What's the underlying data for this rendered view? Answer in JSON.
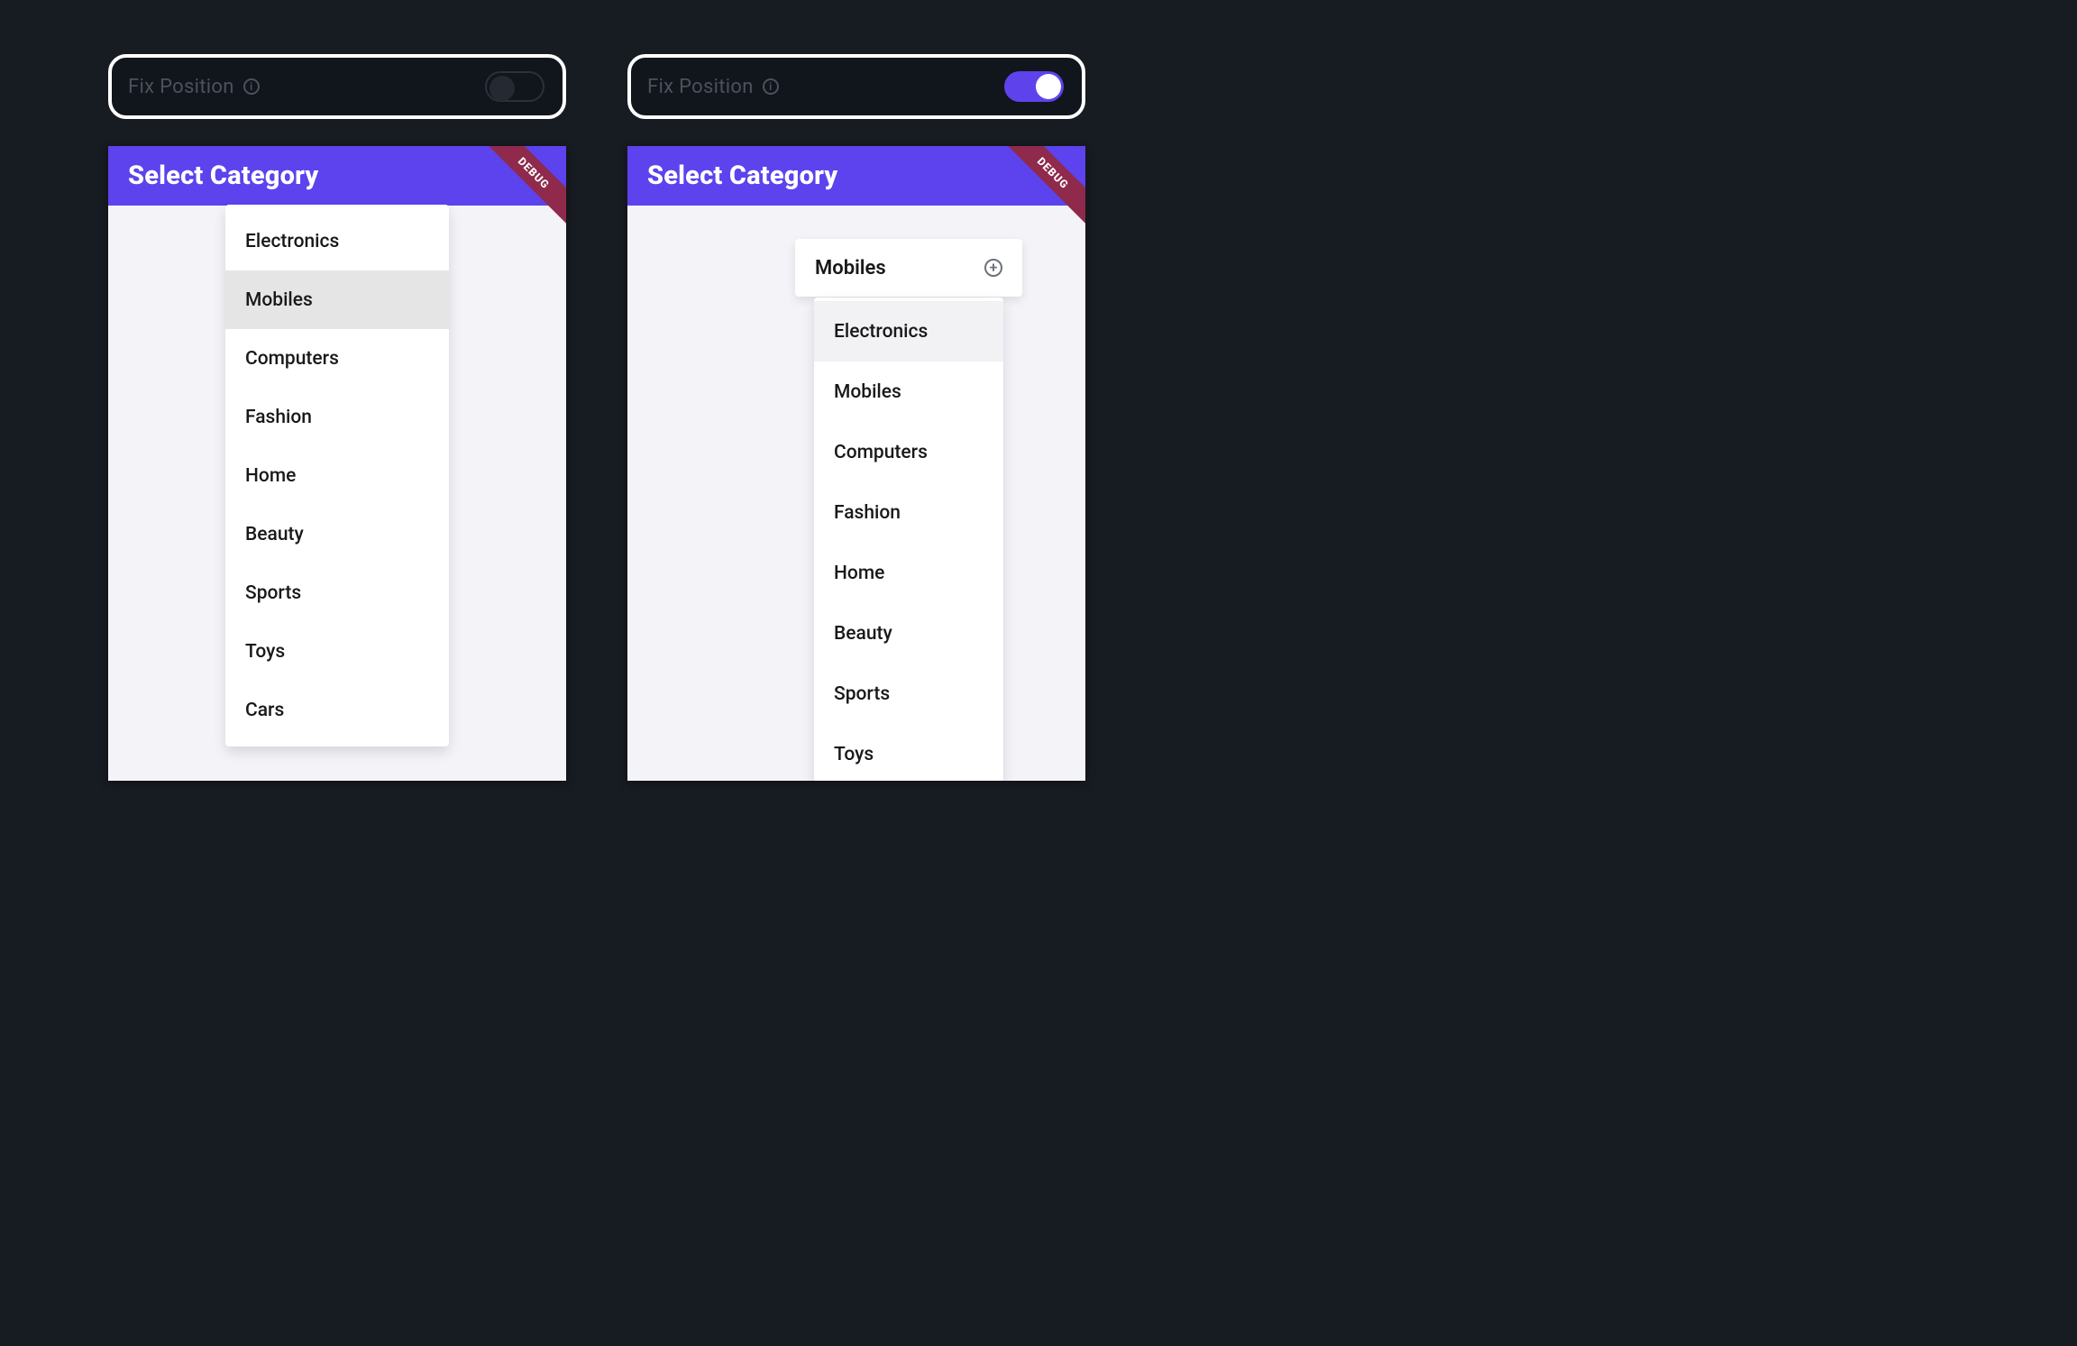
{
  "setting": {
    "label": "Fix Position"
  },
  "app": {
    "title": "Select Category",
    "debug_label": "DEBUG"
  },
  "left": {
    "toggle_on": false,
    "items": [
      {
        "label": "Electronics",
        "selected": false
      },
      {
        "label": "Mobiles",
        "selected": true
      },
      {
        "label": "Computers",
        "selected": false
      },
      {
        "label": "Fashion",
        "selected": false
      },
      {
        "label": "Home",
        "selected": false
      },
      {
        "label": "Beauty",
        "selected": false
      },
      {
        "label": "Sports",
        "selected": false
      },
      {
        "label": "Toys",
        "selected": false
      },
      {
        "label": "Cars",
        "selected": false
      }
    ]
  },
  "right": {
    "toggle_on": true,
    "selected_label": "Mobiles",
    "items": [
      {
        "label": "Electronics",
        "selected": true
      },
      {
        "label": "Mobiles",
        "selected": false
      },
      {
        "label": "Computers",
        "selected": false
      },
      {
        "label": "Fashion",
        "selected": false
      },
      {
        "label": "Home",
        "selected": false
      },
      {
        "label": "Beauty",
        "selected": false
      },
      {
        "label": "Sports",
        "selected": false
      },
      {
        "label": "Toys",
        "selected": false
      }
    ]
  }
}
